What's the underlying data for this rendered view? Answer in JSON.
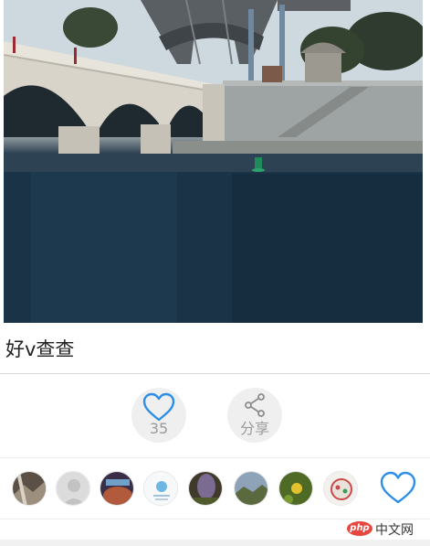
{
  "post": {
    "title": "好v查查",
    "photo_alt": "Eiffel Tower and bridge over the Seine"
  },
  "actions": {
    "like_count": "35",
    "share_label": "分享"
  },
  "likers": [
    {
      "name": "avatar-1"
    },
    {
      "name": "avatar-2"
    },
    {
      "name": "avatar-3"
    },
    {
      "name": "avatar-4"
    },
    {
      "name": "avatar-5"
    },
    {
      "name": "avatar-6"
    },
    {
      "name": "avatar-7"
    },
    {
      "name": "avatar-8"
    }
  ],
  "watermark": {
    "logo": "php",
    "site": "中文网"
  },
  "colors": {
    "accent": "#2d8ee8",
    "action_bg": "#efefef",
    "muted_text": "#9a9a9a",
    "divider": "#d9d9d9"
  }
}
